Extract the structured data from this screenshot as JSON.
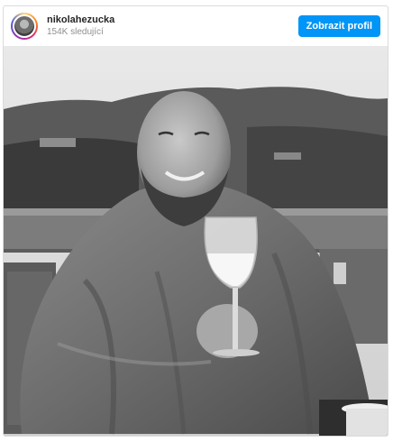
{
  "post": {
    "username": "nikolahezucka",
    "followers": "154K sledující",
    "profile_button_label": "Zobrazit profil"
  },
  "photo": {
    "alt": "Black-and-white photo of a bald bearded man wrapped in a blanket holding a glass of white wine on a terrace with hills behind"
  }
}
